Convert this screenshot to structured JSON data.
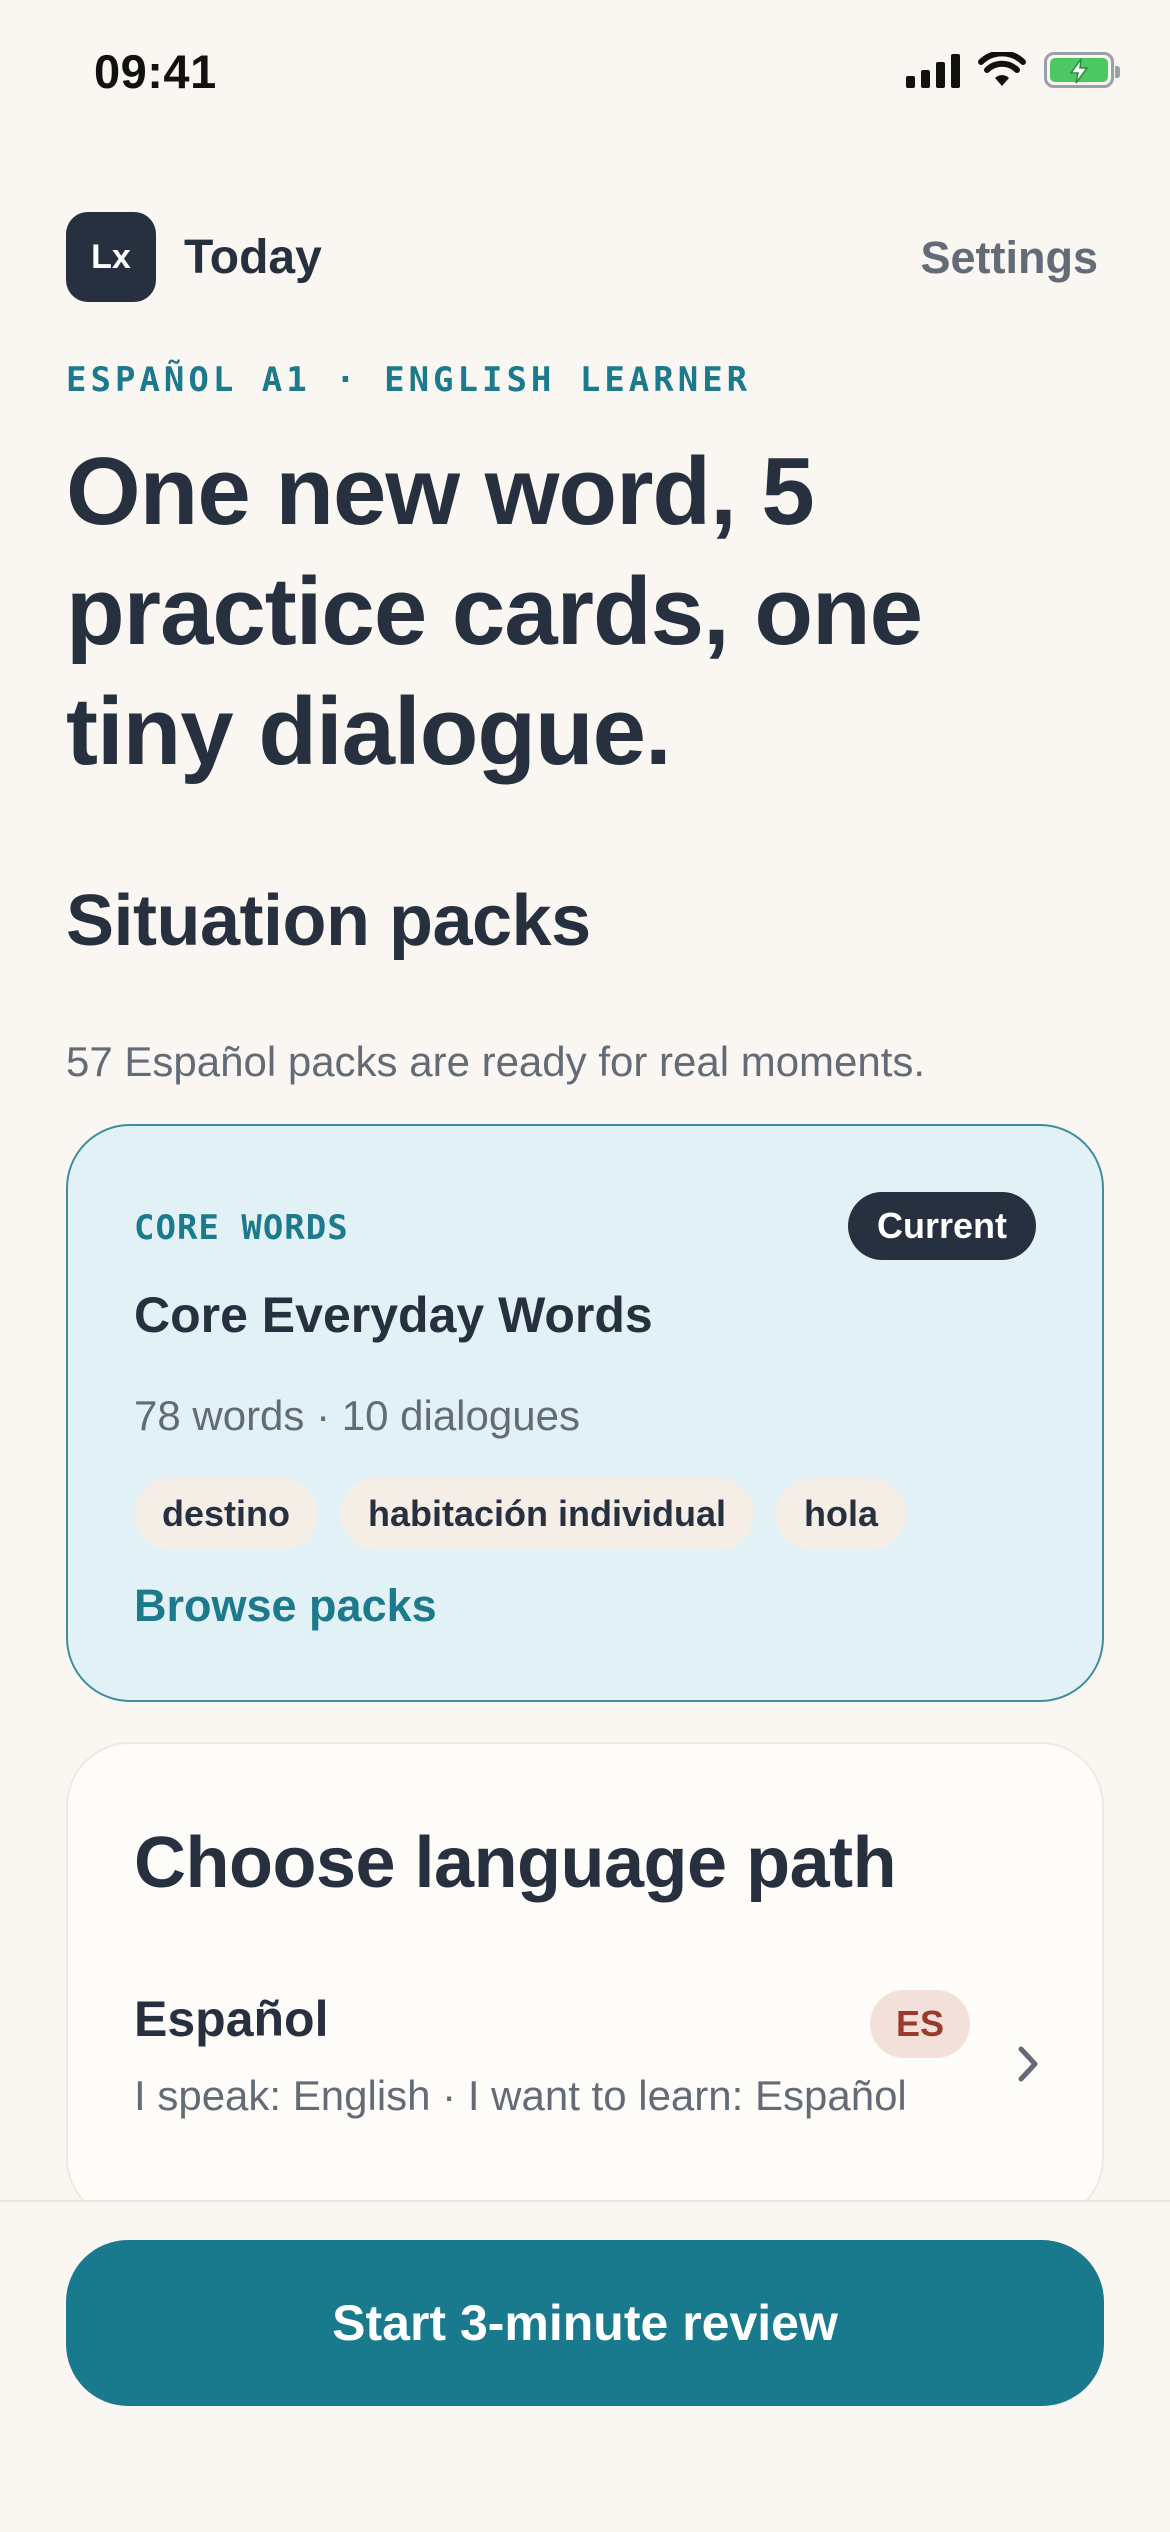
{
  "status_bar": {
    "time": "09:41",
    "battery": {
      "level": 1.0,
      "charging": true,
      "color": "#4CC764"
    }
  },
  "header": {
    "logo_text": "Lx",
    "title": "Today",
    "settings_label": "Settings"
  },
  "hero": {
    "eyebrow": "ESPAÑOL A1 · ENGLISH LEARNER",
    "title": "One new word, 5 practice cards, one tiny dialogue."
  },
  "situation_packs": {
    "title": "Situation packs",
    "subtitle": "57 Español packs are ready for real moments.",
    "card": {
      "eyebrow": "CORE WORDS",
      "badge": "Current",
      "title": "Core Everyday Words",
      "meta": "78 words · 10 dialogues",
      "chips": [
        "destino",
        "habitación individual",
        "hola"
      ],
      "link": "Browse packs"
    }
  },
  "language_path": {
    "title": "Choose language path",
    "item": {
      "name": "Español",
      "code": "ES",
      "description": "I speak: English · I want to learn: Español"
    }
  },
  "cta": {
    "label": "Start 3-minute review"
  },
  "colors": {
    "background": "#FAF6F1",
    "ink": "#27303F",
    "accent": "#197A8D",
    "muted": "#626B76",
    "pack_card_bg": "#E2F1F6",
    "chip_bg": "#F4EEE6",
    "lang_badge_bg": "#F4E0DA",
    "lang_badge_text": "#9A3A2A"
  },
  "icons": {
    "signal": "cellular-signal-icon",
    "wifi": "wifi-icon",
    "battery": "battery-charging-icon",
    "chevron": "chevron-right-icon"
  }
}
